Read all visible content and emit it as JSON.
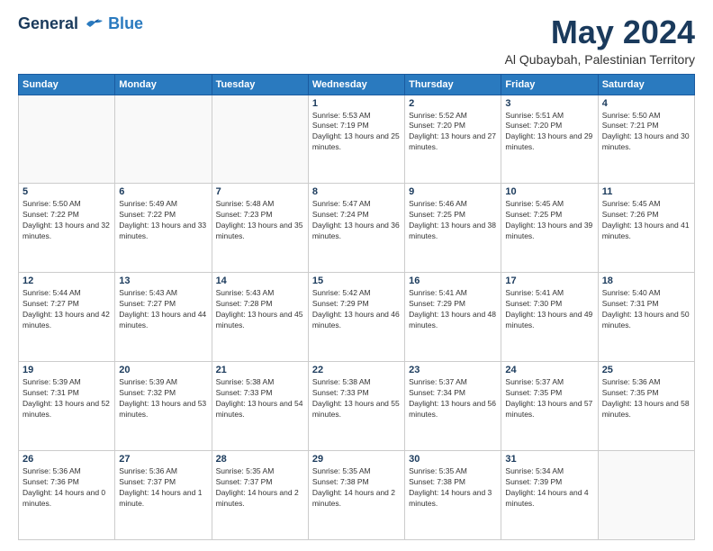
{
  "header": {
    "logo_line1": "General",
    "logo_line2": "Blue",
    "month": "May 2024",
    "location": "Al Qubaybah, Palestinian Territory"
  },
  "weekdays": [
    "Sunday",
    "Monday",
    "Tuesday",
    "Wednesday",
    "Thursday",
    "Friday",
    "Saturday"
  ],
  "weeks": [
    [
      {
        "day": "",
        "sunrise": "",
        "sunset": "",
        "daylight": ""
      },
      {
        "day": "",
        "sunrise": "",
        "sunset": "",
        "daylight": ""
      },
      {
        "day": "",
        "sunrise": "",
        "sunset": "",
        "daylight": ""
      },
      {
        "day": "1",
        "sunrise": "Sunrise: 5:53 AM",
        "sunset": "Sunset: 7:19 PM",
        "daylight": "Daylight: 13 hours and 25 minutes."
      },
      {
        "day": "2",
        "sunrise": "Sunrise: 5:52 AM",
        "sunset": "Sunset: 7:20 PM",
        "daylight": "Daylight: 13 hours and 27 minutes."
      },
      {
        "day": "3",
        "sunrise": "Sunrise: 5:51 AM",
        "sunset": "Sunset: 7:20 PM",
        "daylight": "Daylight: 13 hours and 29 minutes."
      },
      {
        "day": "4",
        "sunrise": "Sunrise: 5:50 AM",
        "sunset": "Sunset: 7:21 PM",
        "daylight": "Daylight: 13 hours and 30 minutes."
      }
    ],
    [
      {
        "day": "5",
        "sunrise": "Sunrise: 5:50 AM",
        "sunset": "Sunset: 7:22 PM",
        "daylight": "Daylight: 13 hours and 32 minutes."
      },
      {
        "day": "6",
        "sunrise": "Sunrise: 5:49 AM",
        "sunset": "Sunset: 7:22 PM",
        "daylight": "Daylight: 13 hours and 33 minutes."
      },
      {
        "day": "7",
        "sunrise": "Sunrise: 5:48 AM",
        "sunset": "Sunset: 7:23 PM",
        "daylight": "Daylight: 13 hours and 35 minutes."
      },
      {
        "day": "8",
        "sunrise": "Sunrise: 5:47 AM",
        "sunset": "Sunset: 7:24 PM",
        "daylight": "Daylight: 13 hours and 36 minutes."
      },
      {
        "day": "9",
        "sunrise": "Sunrise: 5:46 AM",
        "sunset": "Sunset: 7:25 PM",
        "daylight": "Daylight: 13 hours and 38 minutes."
      },
      {
        "day": "10",
        "sunrise": "Sunrise: 5:45 AM",
        "sunset": "Sunset: 7:25 PM",
        "daylight": "Daylight: 13 hours and 39 minutes."
      },
      {
        "day": "11",
        "sunrise": "Sunrise: 5:45 AM",
        "sunset": "Sunset: 7:26 PM",
        "daylight": "Daylight: 13 hours and 41 minutes."
      }
    ],
    [
      {
        "day": "12",
        "sunrise": "Sunrise: 5:44 AM",
        "sunset": "Sunset: 7:27 PM",
        "daylight": "Daylight: 13 hours and 42 minutes."
      },
      {
        "day": "13",
        "sunrise": "Sunrise: 5:43 AM",
        "sunset": "Sunset: 7:27 PM",
        "daylight": "Daylight: 13 hours and 44 minutes."
      },
      {
        "day": "14",
        "sunrise": "Sunrise: 5:43 AM",
        "sunset": "Sunset: 7:28 PM",
        "daylight": "Daylight: 13 hours and 45 minutes."
      },
      {
        "day": "15",
        "sunrise": "Sunrise: 5:42 AM",
        "sunset": "Sunset: 7:29 PM",
        "daylight": "Daylight: 13 hours and 46 minutes."
      },
      {
        "day": "16",
        "sunrise": "Sunrise: 5:41 AM",
        "sunset": "Sunset: 7:29 PM",
        "daylight": "Daylight: 13 hours and 48 minutes."
      },
      {
        "day": "17",
        "sunrise": "Sunrise: 5:41 AM",
        "sunset": "Sunset: 7:30 PM",
        "daylight": "Daylight: 13 hours and 49 minutes."
      },
      {
        "day": "18",
        "sunrise": "Sunrise: 5:40 AM",
        "sunset": "Sunset: 7:31 PM",
        "daylight": "Daylight: 13 hours and 50 minutes."
      }
    ],
    [
      {
        "day": "19",
        "sunrise": "Sunrise: 5:39 AM",
        "sunset": "Sunset: 7:31 PM",
        "daylight": "Daylight: 13 hours and 52 minutes."
      },
      {
        "day": "20",
        "sunrise": "Sunrise: 5:39 AM",
        "sunset": "Sunset: 7:32 PM",
        "daylight": "Daylight: 13 hours and 53 minutes."
      },
      {
        "day": "21",
        "sunrise": "Sunrise: 5:38 AM",
        "sunset": "Sunset: 7:33 PM",
        "daylight": "Daylight: 13 hours and 54 minutes."
      },
      {
        "day": "22",
        "sunrise": "Sunrise: 5:38 AM",
        "sunset": "Sunset: 7:33 PM",
        "daylight": "Daylight: 13 hours and 55 minutes."
      },
      {
        "day": "23",
        "sunrise": "Sunrise: 5:37 AM",
        "sunset": "Sunset: 7:34 PM",
        "daylight": "Daylight: 13 hours and 56 minutes."
      },
      {
        "day": "24",
        "sunrise": "Sunrise: 5:37 AM",
        "sunset": "Sunset: 7:35 PM",
        "daylight": "Daylight: 13 hours and 57 minutes."
      },
      {
        "day": "25",
        "sunrise": "Sunrise: 5:36 AM",
        "sunset": "Sunset: 7:35 PM",
        "daylight": "Daylight: 13 hours and 58 minutes."
      }
    ],
    [
      {
        "day": "26",
        "sunrise": "Sunrise: 5:36 AM",
        "sunset": "Sunset: 7:36 PM",
        "daylight": "Daylight: 14 hours and 0 minutes."
      },
      {
        "day": "27",
        "sunrise": "Sunrise: 5:36 AM",
        "sunset": "Sunset: 7:37 PM",
        "daylight": "Daylight: 14 hours and 1 minute."
      },
      {
        "day": "28",
        "sunrise": "Sunrise: 5:35 AM",
        "sunset": "Sunset: 7:37 PM",
        "daylight": "Daylight: 14 hours and 2 minutes."
      },
      {
        "day": "29",
        "sunrise": "Sunrise: 5:35 AM",
        "sunset": "Sunset: 7:38 PM",
        "daylight": "Daylight: 14 hours and 2 minutes."
      },
      {
        "day": "30",
        "sunrise": "Sunrise: 5:35 AM",
        "sunset": "Sunset: 7:38 PM",
        "daylight": "Daylight: 14 hours and 3 minutes."
      },
      {
        "day": "31",
        "sunrise": "Sunrise: 5:34 AM",
        "sunset": "Sunset: 7:39 PM",
        "daylight": "Daylight: 14 hours and 4 minutes."
      },
      {
        "day": "",
        "sunrise": "",
        "sunset": "",
        "daylight": ""
      }
    ]
  ]
}
